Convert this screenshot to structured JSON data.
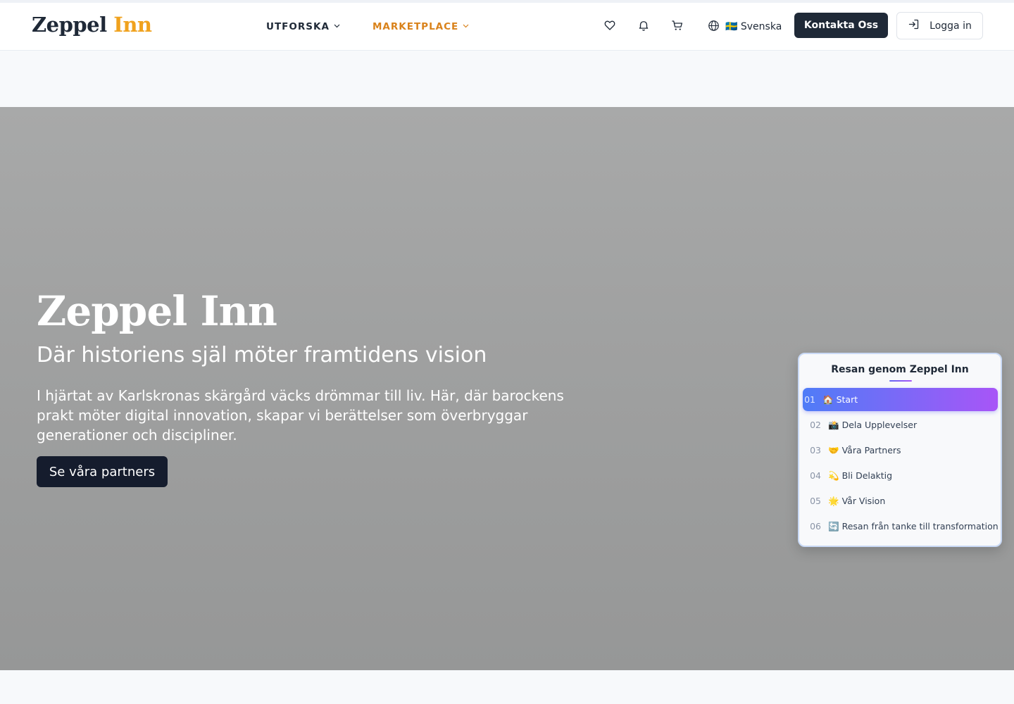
{
  "header": {
    "logo_main": "Zeppel",
    "logo_accent": "Inn",
    "nav": [
      {
        "label": "UTFORSKA",
        "color": "#1f2937"
      },
      {
        "label": "MARKETPLACE",
        "color": "#d9821b"
      }
    ],
    "icons": [
      "heart-icon",
      "bell-icon",
      "cart-icon",
      "globe-icon"
    ],
    "language": "🇸🇪 Svenska",
    "contact_label": "Kontakta Oss",
    "login_label": "Logga in"
  },
  "hero": {
    "title": "Zeppel Inn",
    "subtitle": "Där historiens själ möter framtidens vision",
    "text": "I hjärtat av Karlskronas skärgård väcks drömmar till liv. Här, där barockens prakt möter digital innovation, skapar vi berättelser som överbryggar generationer och discipliner.",
    "cta_label": "Se våra partners"
  },
  "journey": {
    "title": "Resan genom Zeppel Inn",
    "items": [
      {
        "num": "01",
        "emoji": "🏠",
        "label": "Start",
        "active": true
      },
      {
        "num": "02",
        "emoji": "📸",
        "label": "Dela Upplevelser",
        "active": false
      },
      {
        "num": "03",
        "emoji": "🤝",
        "label": "Våra Partners",
        "active": false
      },
      {
        "num": "04",
        "emoji": "💫",
        "label": "Bli Delaktig",
        "active": false
      },
      {
        "num": "05",
        "emoji": "🌟",
        "label": "Vår Vision",
        "active": false
      },
      {
        "num": "06",
        "emoji": "🔄",
        "label": "Resan från tanke till transformation",
        "active": false
      }
    ]
  },
  "colors": {
    "brand_accent": "#f0a21e",
    "dark": "#1f2937",
    "journey_gradient_start": "#4f7cf7",
    "journey_gradient_end": "#a855f7"
  }
}
